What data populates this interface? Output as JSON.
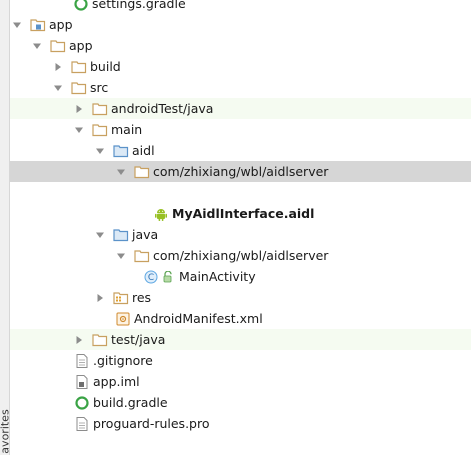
{
  "side_tab": {
    "label": "avorites"
  },
  "tree": {
    "settings_gradle": "settings.gradle",
    "app_module": "app",
    "app_folder": "app",
    "build_folder": "build",
    "src_folder": "src",
    "android_test": "androidTest/java",
    "main_folder": "main",
    "aidl_folder": "aidl",
    "aidl_package": "com/zhixiang/wbl/aidlserver",
    "aidl_file": "MyAidlInterface.aidl",
    "java_folder": "java",
    "java_package": "com/zhixiang/wbl/aidlserver",
    "main_activity": "MainActivity",
    "res_folder": "res",
    "manifest": "AndroidManifest.xml",
    "test_java": "test/java",
    "gitignore": ".gitignore",
    "app_iml": "app.iml",
    "build_gradle": "build.gradle",
    "proguard": "proguard-rules.pro"
  },
  "colors": {
    "folder": "#c8a060",
    "source_folder": "#5b92c9",
    "android_green": "#97c024",
    "class_blue": "#5fa8e3",
    "selection": "#d6d6d6",
    "row_alt": "#f5fbf1"
  }
}
